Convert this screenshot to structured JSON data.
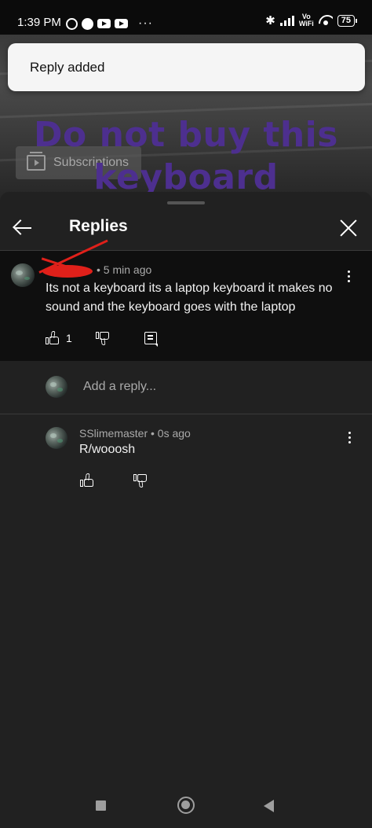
{
  "status_bar": {
    "time": "1:39 PM",
    "overflow": "···",
    "vo_wifi_top": "Vo",
    "vo_wifi_bottom": "WiFi",
    "battery": "75",
    "icons": [
      "alarm-icon",
      "messenger-icon",
      "youtube-icon",
      "youtube-icon",
      "bluetooth-icon",
      "signal-icon",
      "vowifi-icon",
      "wifi-icon",
      "battery-icon"
    ]
  },
  "snackbar": {
    "message": "Reply added"
  },
  "video": {
    "title_line1": "Do not buy this",
    "title_line2": "keyboard",
    "subscriptions_label": "Subscriptions"
  },
  "sheet": {
    "title": "Replies"
  },
  "parent_comment": {
    "meta": "• 5 min ago",
    "text": "Its not a keyboard its a laptop keyboard it makes no sound and the keyboard goes with the laptop",
    "like_count": "1"
  },
  "add_reply": {
    "placeholder": "Add a reply..."
  },
  "reply": {
    "meta": "SSlimemaster • 0s ago",
    "text": "R/wooosh"
  },
  "colors": {
    "sheet_bg": "#212121",
    "parent_bg": "#0f0f0f",
    "video_title": "#4d2f8f",
    "redaction": "#e0201a"
  }
}
